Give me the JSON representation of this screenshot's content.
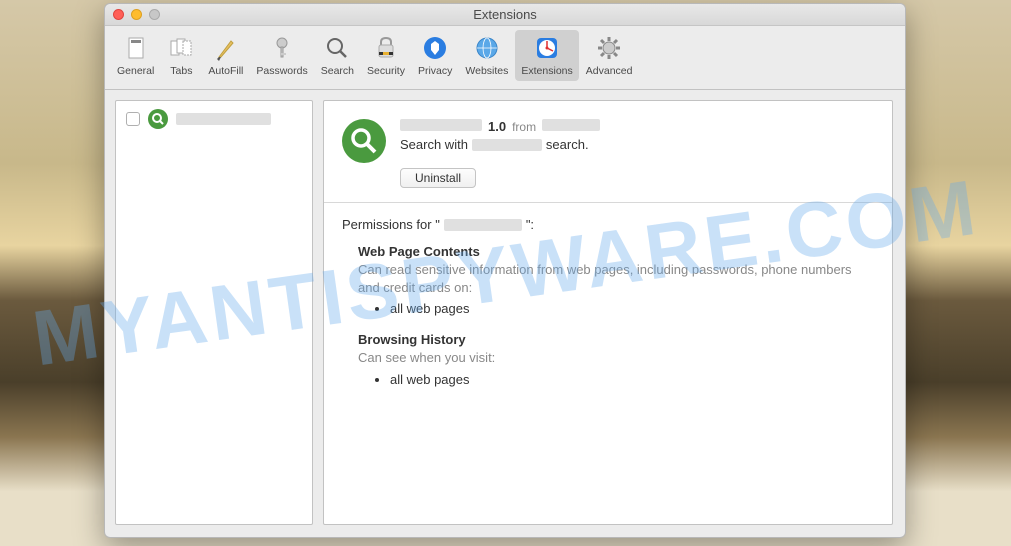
{
  "window": {
    "title": "Extensions"
  },
  "watermark": "MYANTISPYWARE.COM",
  "toolbar": {
    "items": [
      {
        "label": "General",
        "icon": "general-icon"
      },
      {
        "label": "Tabs",
        "icon": "tabs-icon"
      },
      {
        "label": "AutoFill",
        "icon": "autofill-icon"
      },
      {
        "label": "Passwords",
        "icon": "passwords-icon"
      },
      {
        "label": "Search",
        "icon": "search-icon"
      },
      {
        "label": "Security",
        "icon": "security-icon"
      },
      {
        "label": "Privacy",
        "icon": "privacy-icon"
      },
      {
        "label": "Websites",
        "icon": "websites-icon"
      },
      {
        "label": "Extensions",
        "icon": "extensions-icon",
        "selected": true
      },
      {
        "label": "Advanced",
        "icon": "advanced-icon"
      }
    ]
  },
  "sidebar": {
    "items": [
      {
        "checked": false
      }
    ]
  },
  "details": {
    "version": "1.0",
    "from_label": "from",
    "desc_prefix": "Search with",
    "desc_suffix": "search.",
    "uninstall_label": "Uninstall",
    "permissions_label_prefix": "Permissions for \"",
    "permissions_label_suffix": "\":",
    "permissions": [
      {
        "heading": "Web Page Contents",
        "desc": "Can read sensitive information from web pages, including passwords, phone numbers and credit cards on:",
        "items": [
          "all web pages"
        ]
      },
      {
        "heading": "Browsing History",
        "desc": "Can see when you visit:",
        "items": [
          "all web pages"
        ]
      }
    ]
  }
}
